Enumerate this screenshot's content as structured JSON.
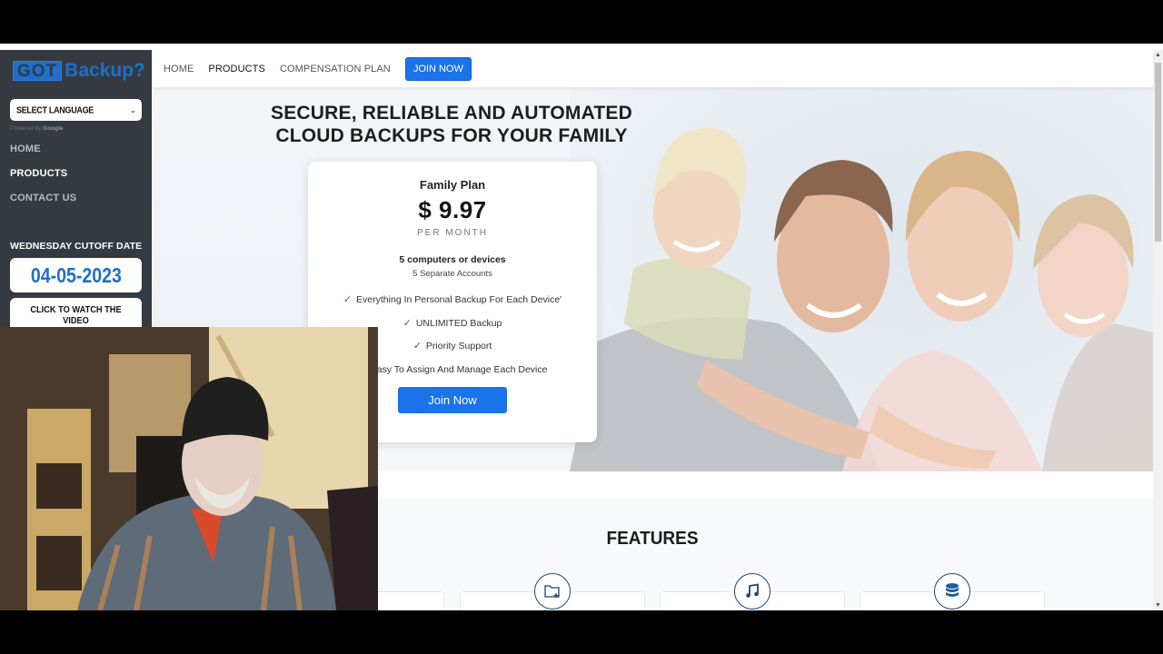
{
  "sidebar": {
    "logo": {
      "part1": "GOT",
      "part2": "Backup?"
    },
    "language_select": {
      "selected": "SELECT LANGUAGE"
    },
    "powered_by": {
      "prefix": "Powered by",
      "brand": "Google"
    },
    "nav": [
      {
        "label": "HOME",
        "active": false
      },
      {
        "label": "PRODUCTS",
        "active": true
      },
      {
        "label": "CONTACT US",
        "active": false
      }
    ],
    "cutoff_label": "WEDNESDAY CUTOFF DATE",
    "cutoff_date": "04-05-2023",
    "video_button": "CLICK TO WATCH THE VIDEO"
  },
  "topnav": {
    "items": [
      {
        "label": "HOME",
        "active": false
      },
      {
        "label": "PRODUCTS",
        "active": true
      },
      {
        "label": "COMPENSATION PLAN",
        "active": false
      }
    ],
    "join_button": "JOIN NOW"
  },
  "hero": {
    "headline_line1": "SECURE, RELIABLE AND AUTOMATED",
    "headline_line2": "CLOUD BACKUPS FOR YOUR FAMILY",
    "image_alt": "smiling family of four"
  },
  "plan": {
    "name": "Family Plan",
    "price": "$ 9.97",
    "period": "PER MONTH",
    "devices": "5 computers or devices",
    "accounts": "5 Separate Accounts",
    "features": [
      "Everything In Personal Backup For Each Device'",
      "UNLIMITED Backup",
      "Priority Support",
      "Easy To Assign And Manage Each Device"
    ],
    "button": "Join Now"
  },
  "features": {
    "title": "FEATURES",
    "icons": [
      "folder-plus-icon",
      "music-note-icon",
      "database-icon"
    ]
  },
  "colors": {
    "accent": "#1a73e8",
    "sidebar_bg": "#343a40",
    "logo_blue": "#1f6fc8",
    "check_green": "#1b7a59",
    "icon_navy": "#1f4569"
  }
}
